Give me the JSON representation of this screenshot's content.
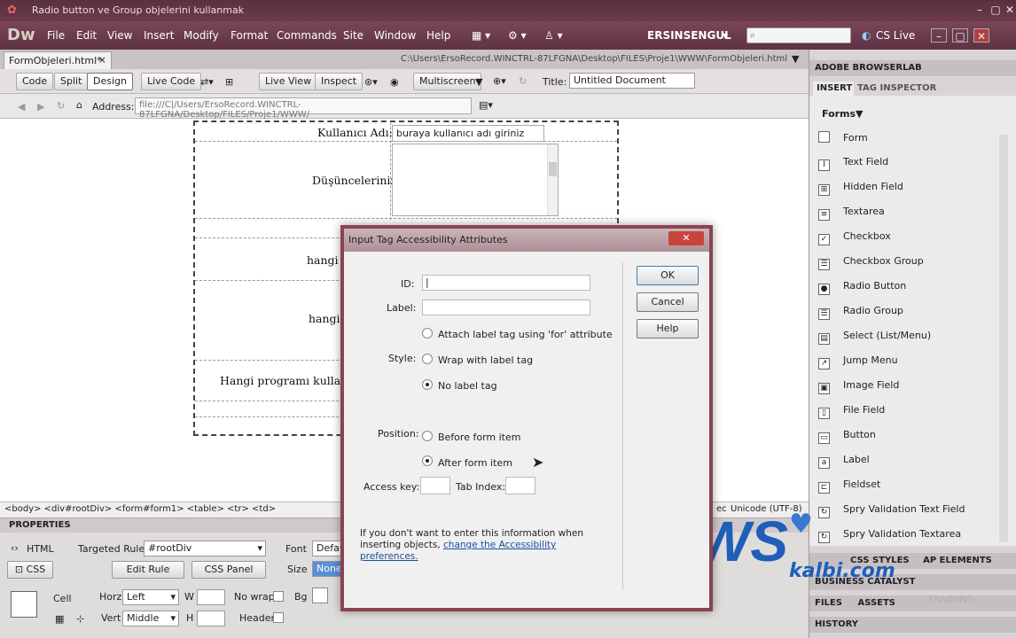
{
  "window": {
    "title": "Radio button ve Group objelerini kullanmak"
  },
  "menubar": {
    "logo": "Dw",
    "items": [
      "File",
      "Edit",
      "View",
      "Insert",
      "Modify",
      "Format",
      "Commands",
      "Site",
      "Window",
      "Help"
    ],
    "user": "ERSINSENGUL",
    "cslive": "CS Live"
  },
  "document": {
    "tab": "FormObjeleri.html*",
    "path": "C:\\Users\\ErsoRecord.WINCTRL-87LFGNA\\Desktop\\FILES\\Proje1\\WWW\\FormObjeleri.html",
    "toolbar": {
      "code": "Code",
      "split": "Split",
      "design": "Design",
      "live_code": "Live Code",
      "live_view": "Live View",
      "inspect": "Inspect",
      "multiscreen": "Multiscreen",
      "title_label": "Title:",
      "title_value": "Untitled Document"
    },
    "address_label": "Address:",
    "address_value": "file:///C|/Users/ErsoRecord.WINCTRL-87LFGNA/Desktop/FILES/Proje1/WWW/"
  },
  "form": {
    "username_label": "Kullanıcı Adı:",
    "username_value": "buraya kullanıcı adı giriniz",
    "thoughts_label": "Düşünceleriniz:",
    "row3_label": "hangi p",
    "row4_label": "hangi",
    "row5_label": "Hangi programı kullanıy"
  },
  "tagbar": {
    "path": "<body> <div#rootDiv> <form#form1> <table> <tr> <td>",
    "encoding": "Unicode (UTF-8)",
    "extra": "ec"
  },
  "properties": {
    "header": "PROPERTIES",
    "html_btn": "HTML",
    "css_btn": "CSS",
    "targeted_rule_label": "Targeted Rule",
    "targeted_rule_value": "#rootDiv",
    "edit_rule": "Edit Rule",
    "css_panel": "CSS Panel",
    "font_label": "Font",
    "font_value": "Defau",
    "size_label": "Size",
    "size_value": "None",
    "cell_label": "Cell",
    "horz_label": "Horz",
    "horz_value": "Left",
    "vert_label": "Vert",
    "vert_value": "Middle",
    "w_label": "W",
    "h_label": "H",
    "nowrap_label": "No wrap",
    "header_label": "Header",
    "bg_label": "Bg"
  },
  "right_panel": {
    "browserlab": "ADOBE BROWSERLAB",
    "insert_tab": "INSERT",
    "tag_inspector_tab": "TAG INSPECTOR",
    "category": "Forms",
    "items": [
      "Form",
      "Text Field",
      "Hidden Field",
      "Textarea",
      "Checkbox",
      "Checkbox Group",
      "Radio Button",
      "Radio Group",
      "Select (List/Menu)",
      "Jump Menu",
      "Image Field",
      "File Field",
      "Button",
      "Label",
      "Fieldset",
      "Spry Validation Text Field",
      "Spry Validation Textarea"
    ],
    "css_styles": "CSS STYLES",
    "ap_elements": "AP ELEMENTS",
    "business_catalyst": "BUSINESS CATALYST",
    "files": "FILES",
    "assets": "ASSETS",
    "history": "HISTORY"
  },
  "dialog": {
    "title": "Input Tag Accessibility Attributes",
    "id_label": "ID:",
    "label_label": "Label:",
    "style_label": "Style:",
    "style_options": [
      "Attach label tag using 'for' attribute",
      "Wrap with label tag",
      "No label tag"
    ],
    "position_label": "Position:",
    "position_options": [
      "Before form item",
      "After form item"
    ],
    "access_key_label": "Access key:",
    "tab_index_label": "Tab Index:",
    "ok": "OK",
    "cancel": "Cancel",
    "help": "Help",
    "note": "If you don't want to enter this information when inserting objects,",
    "note_link": "change the Accessibility preferences."
  },
  "watermark": {
    "main": "WS",
    "sub": "kalbi.com",
    "training": "TRAINING"
  }
}
